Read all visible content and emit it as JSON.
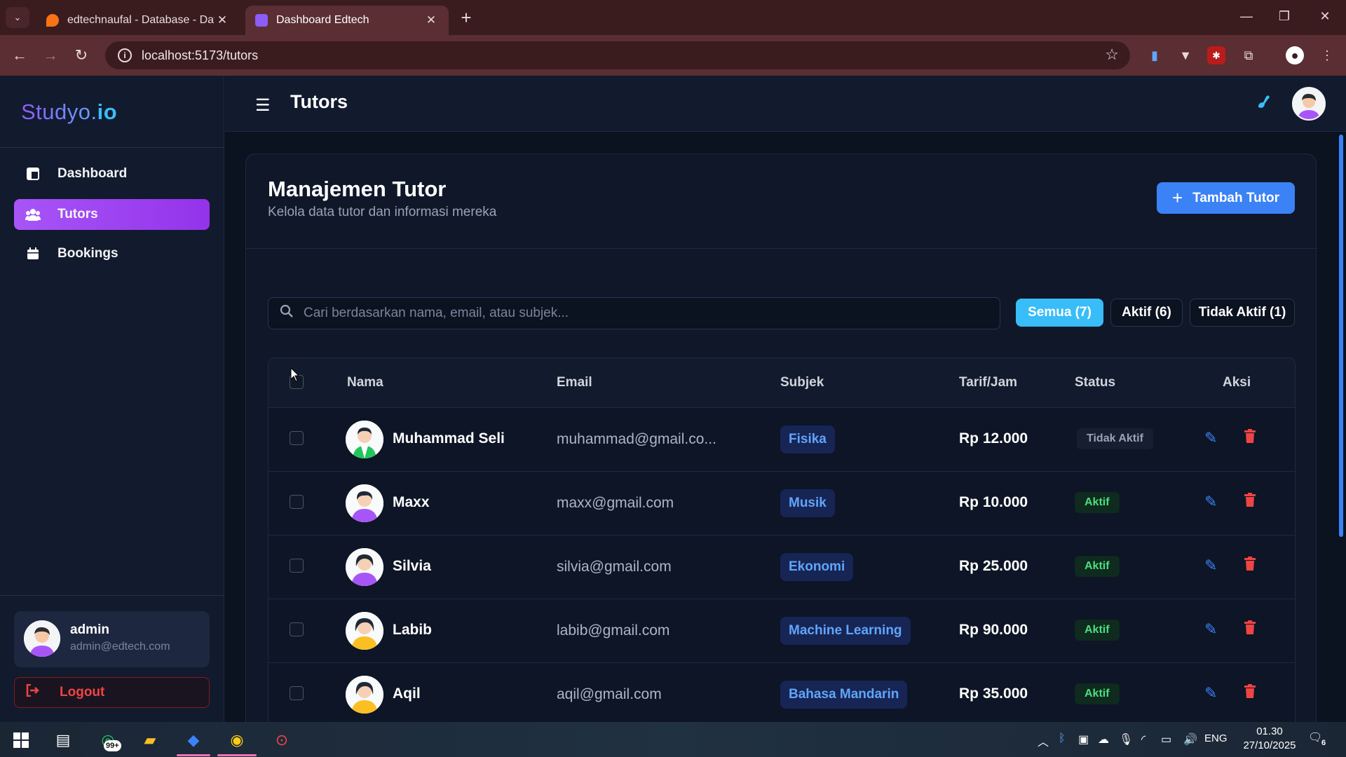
{
  "browser": {
    "tabs": [
      {
        "title": "edtechnaufal - Database - Data",
        "favicon_color": "#f97316",
        "active": false
      },
      {
        "title": "Dashboard Edtech",
        "favicon_color": "#8b5cf6",
        "active": true
      }
    ],
    "url": "localhost:5173/tutors"
  },
  "sidebar": {
    "logo_main": "Studyo.",
    "logo_accent": "io",
    "nav": [
      {
        "label": "Dashboard",
        "icon": "dashboard-icon"
      },
      {
        "label": "Tutors",
        "icon": "users-icon"
      },
      {
        "label": "Bookings",
        "icon": "calendar-icon"
      }
    ],
    "user": {
      "name": "admin",
      "email": "admin@edtech.com"
    },
    "logout_label": "Logout"
  },
  "topbar": {
    "title": "Tutors"
  },
  "page": {
    "title": "Manajemen Tutor",
    "subtitle": "Kelola data tutor dan informasi mereka",
    "add_button": "Tambah Tutor",
    "search_placeholder": "Cari berdasarkan nama, email, atau subjek...",
    "filters": [
      "Semua (7)",
      "Aktif (6)",
      "Tidak Aktif (1)"
    ]
  },
  "table": {
    "headers": {
      "name": "Nama",
      "email": "Email",
      "subject": "Subjek",
      "rate": "Tarif/Jam",
      "status": "Status",
      "actions": "Aksi"
    },
    "rows": [
      {
        "name": "Muhammad Seli",
        "email": "muhammad@gmail.co...",
        "subject": "Fisika",
        "rate": "Rp 12.000",
        "status": "Tidak Aktif",
        "active": false
      },
      {
        "name": "Maxx",
        "email": "maxx@gmail.com",
        "subject": "Musik",
        "rate": "Rp 10.000",
        "status": "Aktif",
        "active": true
      },
      {
        "name": "Silvia",
        "email": "silvia@gmail.com",
        "subject": "Ekonomi",
        "rate": "Rp 25.000",
        "status": "Aktif",
        "active": true
      },
      {
        "name": "Labib",
        "email": "labib@gmail.com",
        "subject": "Machine Learning",
        "rate": "Rp 90.000",
        "status": "Aktif",
        "active": true
      },
      {
        "name": "Aqil",
        "email": "aqil@gmail.com",
        "subject": "Bahasa Mandarin",
        "rate": "Rp 35.000",
        "status": "Aktif",
        "active": true
      }
    ]
  },
  "taskbar": {
    "whatsapp_badge": "99+",
    "language": "ENG",
    "time": "01.30",
    "date": "27/10/2025",
    "notifications": "6"
  },
  "colors": {
    "accent_purple": "#a855f7",
    "accent_blue": "#3b82f6",
    "status_green": "#4ade80",
    "danger": "#ef4444"
  }
}
